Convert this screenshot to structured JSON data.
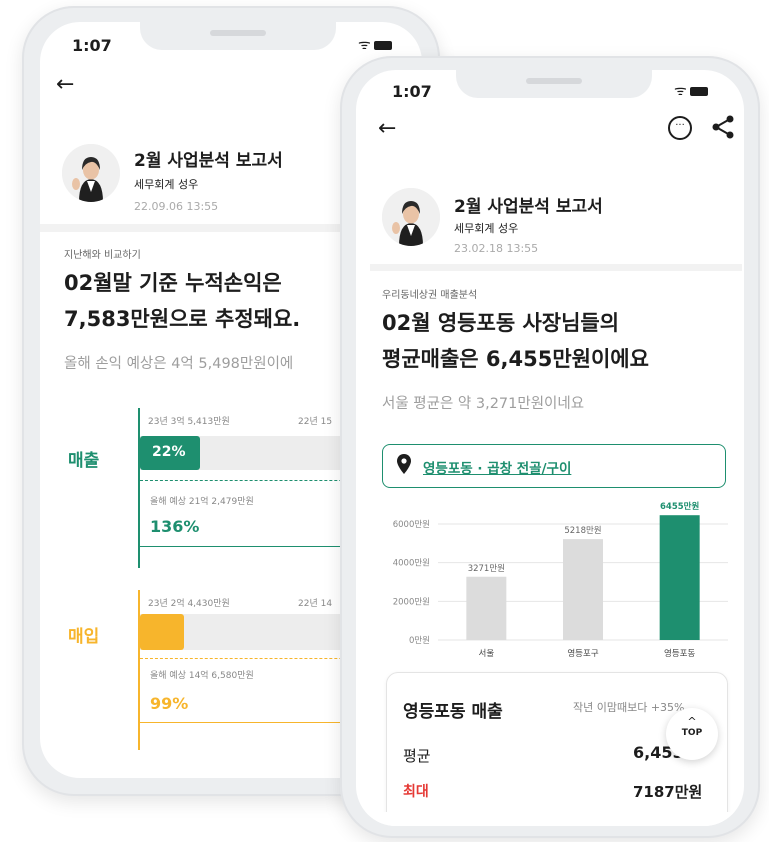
{
  "left_phone": {
    "status": {
      "time": "1:07"
    },
    "report": {
      "title": "2월 사업분석 보고서",
      "author": "세무회계 성우",
      "date": "22.09.06 13:55"
    },
    "compare_label": "지난해와 비교하기",
    "headline_line1": "02월말 기준 누적손익은",
    "headline_line2": "7,583만원으로 추정돼요.",
    "subline": "올해 손익 예상은 4억 5,498만원이에",
    "sales": {
      "label": "매출",
      "current_caption": "23년 3억 5,413만원",
      "prev_caption": "22년 15",
      "current_pct": "22%",
      "forecast_caption": "올해 예상 21억 2,479만원",
      "forecast_pct": "136%",
      "color": "#1e8f6f"
    },
    "purchase": {
      "label": "매입",
      "current_caption": "23년 2억 4,430만원",
      "prev_caption": "22년 14",
      "forecast_caption": "올해 예상 14억 6,580만원",
      "forecast_pct": "99%",
      "color": "#f7b52c"
    }
  },
  "right_phone": {
    "status": {
      "time": "1:07"
    },
    "report": {
      "title": "2월 사업분석 보고서",
      "author": "세무회계 성우",
      "date": "23.02.18 13:55"
    },
    "section_label": "우리동네상권 매출분석",
    "headline_line1": "02월 영등포동 사장님들의",
    "headline_line2": "평균매출은 6,455만원이에요",
    "subline": "서울 평균은 약 3,271만원이네요",
    "location": {
      "text": "영등포동 · 곱창 전골/구이"
    },
    "card": {
      "title": "영등포동 매출",
      "compare": "작년 이맘때보다 +35%",
      "avg_label": "평균",
      "avg_value": "6,455",
      "max_label": "최대",
      "max_value": "7187만원"
    },
    "top_button": {
      "label": "TOP"
    }
  },
  "chart_data": {
    "type": "bar",
    "categories": [
      "서울",
      "영등포구",
      "영등포동"
    ],
    "values": [
      3271,
      5218,
      6455
    ],
    "value_labels": [
      "3271만원",
      "5218만원",
      "6455만원"
    ],
    "y_ticks": [
      "0만원",
      "2000만원",
      "4000만원",
      "6000만원"
    ],
    "ylim": [
      0,
      6000
    ],
    "bar_colors": [
      "#dcdcdc",
      "#dcdcdc",
      "#1e8f6f"
    ],
    "highlight_label_color": "#1e8f6f",
    "grid": true
  }
}
